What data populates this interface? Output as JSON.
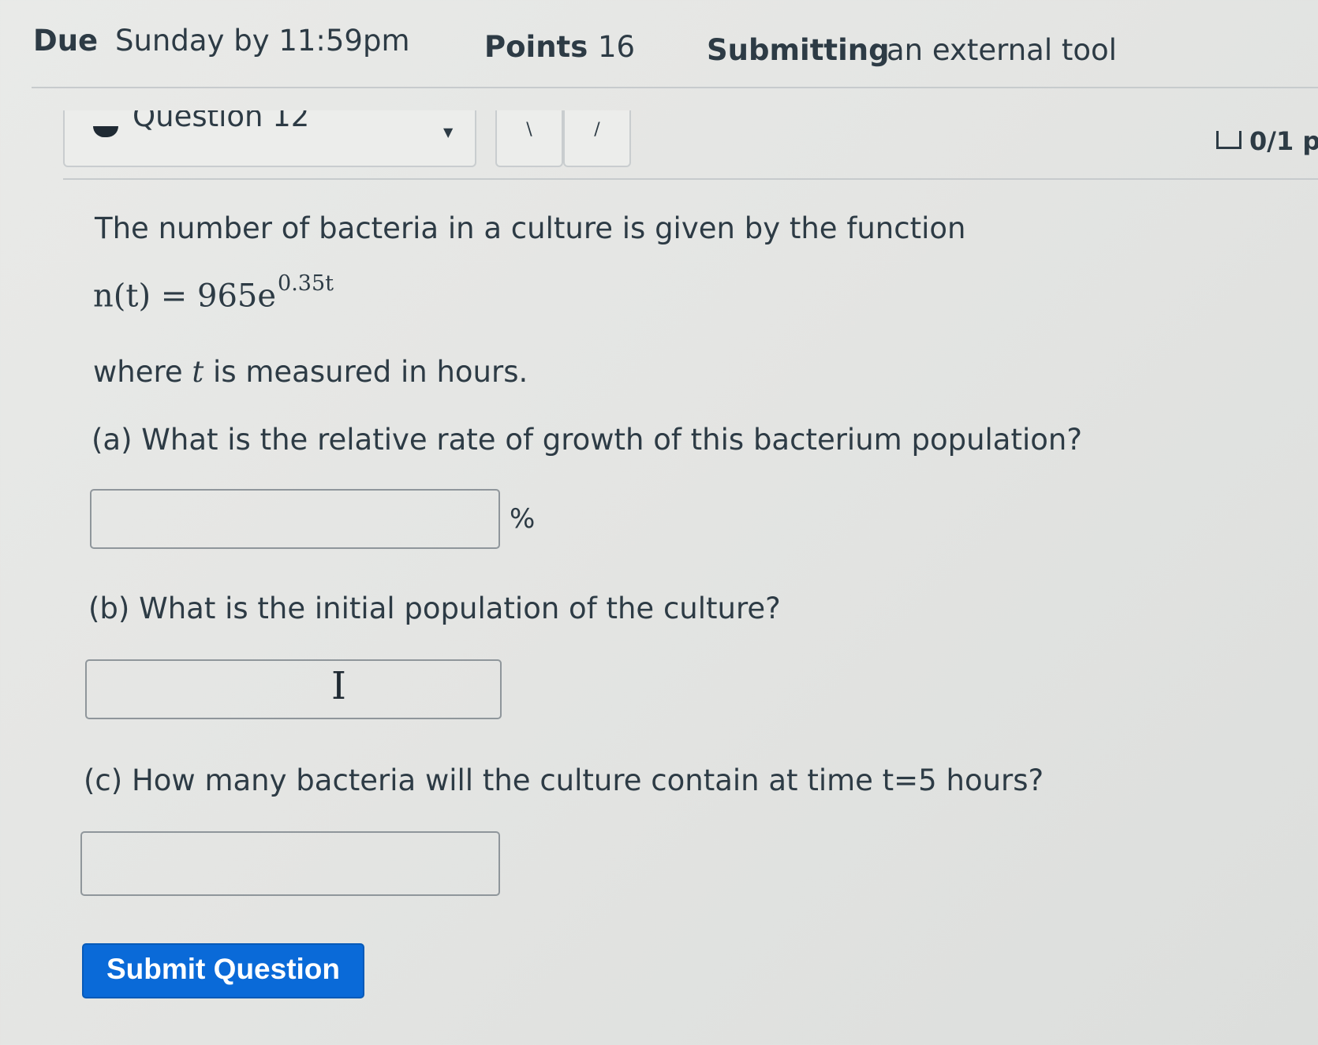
{
  "header": {
    "due_label": "Due",
    "due_value": "Sunday by 11:59pm",
    "points_label": "Points",
    "points_value": "16",
    "submitting_label": "Submitting",
    "submitting_value": "an external tool"
  },
  "question_nav": {
    "selector_label": "Question 12",
    "prev_glyph": "\\",
    "next_glyph": "/"
  },
  "score": {
    "value": "0/1 p"
  },
  "problem": {
    "intro": "The number of bacteria in a culture is given by the function",
    "equation_base": "n(t) = 965e",
    "equation_exponent": "0.35t",
    "where_prefix": "where ",
    "where_var": "t",
    "where_suffix": " is measured in hours.",
    "part_a": "(a) What is the relative rate of growth of this bacterium population?",
    "part_a_unit": "%",
    "part_b": "(b) What is the initial population of the culture?",
    "part_c": "(c) How many bacteria will the culture contain at time t=5 hours?"
  },
  "answers": {
    "a_value": "",
    "b_value": "",
    "c_value": ""
  },
  "buttons": {
    "submit_label": "Submit Question"
  },
  "colors": {
    "text": "#2d3b45",
    "submit_bg": "#0a6ad8",
    "input_border": "#8f969b"
  },
  "icons": {
    "score": "checkbox-icon",
    "cursor": "text-cursor-icon",
    "dropdown": "caret-down-icon"
  }
}
